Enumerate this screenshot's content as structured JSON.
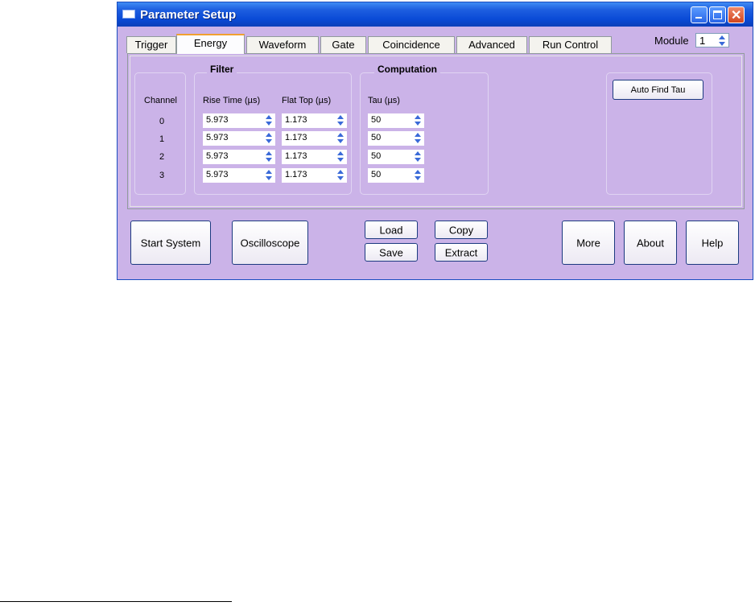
{
  "window": {
    "title": "Parameter Setup"
  },
  "tabs": [
    "Trigger",
    "Energy",
    "Waveform",
    "Gate",
    "Coincidence",
    "Advanced",
    "Run Control"
  ],
  "active_tab": "Energy",
  "module": {
    "label": "Module",
    "value": "1"
  },
  "filter": {
    "title": "Filter",
    "channel_header": "Channel",
    "rise_header": "Rise Time (µs)",
    "flat_header": "Flat Top (µs)",
    "channels": [
      "0",
      "1",
      "2",
      "3"
    ],
    "rise": [
      "5.973",
      "5.973",
      "5.973",
      "5.973"
    ],
    "flat": [
      "1.173",
      "1.173",
      "1.173",
      "1.173"
    ]
  },
  "computation": {
    "title": "Computation",
    "tau_header": "Tau (µs)",
    "tau": [
      "50",
      "50",
      "50",
      "50"
    ]
  },
  "buttons": {
    "auto_find_tau": "Auto Find Tau",
    "start_system": "Start System",
    "oscilloscope": "Oscilloscope",
    "load": "Load",
    "save": "Save",
    "copy": "Copy",
    "extract": "Extract",
    "more": "More",
    "about": "About",
    "help": "Help"
  },
  "colors": {
    "background": "#cbb3e8",
    "titlebar": "#0a4ad6",
    "active_tab_accent": "#f0a030"
  }
}
